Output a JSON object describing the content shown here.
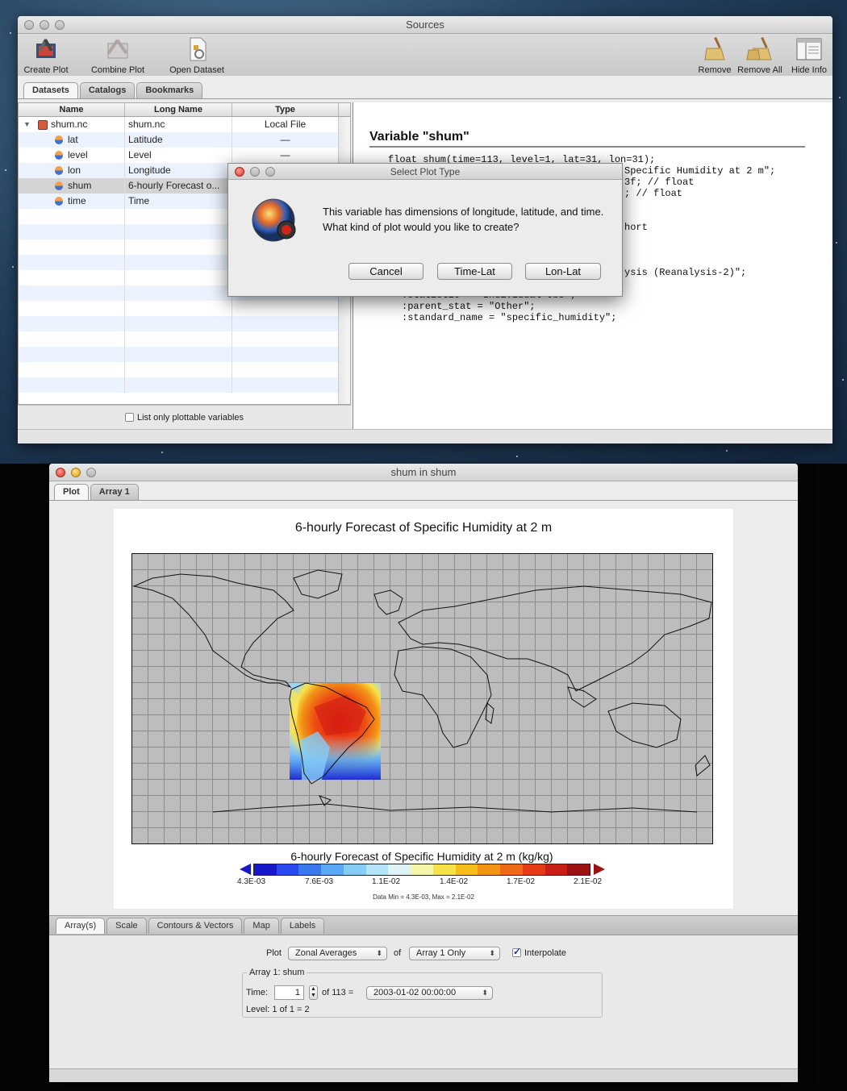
{
  "sources_window": {
    "title": "Sources",
    "toolbar": {
      "create_plot": "Create Plot",
      "combine_plot": "Combine Plot",
      "open_dataset": "Open Dataset",
      "remove": "Remove",
      "remove_all": "Remove All",
      "hide_info": "Hide Info"
    },
    "tabs": [
      "Datasets",
      "Catalogs",
      "Bookmarks"
    ],
    "table": {
      "columns": [
        "Name",
        "Long Name",
        "Type"
      ],
      "rows": [
        {
          "name": "shum.nc",
          "long_name": "shum.nc",
          "type": "Local File"
        },
        {
          "name": "lat",
          "long_name": "Latitude",
          "type": "—"
        },
        {
          "name": "level",
          "long_name": "Level",
          "type": "—"
        },
        {
          "name": "lon",
          "long_name": "Longitude",
          "type": ""
        },
        {
          "name": "shum",
          "long_name": "6-hourly Forecast o...",
          "type": ""
        },
        {
          "name": "time",
          "long_name": "Time",
          "type": ""
        }
      ]
    },
    "plottable_checkbox": "List only plottable variables",
    "info": {
      "title": "Variable \"shum\"",
      "code_lines": [
        "float shum(time=113, level=1, lat=31, lon=31);",
        "Specific Humidity at 2 m\";",
        "3f; // float",
        "; // float",
        "hort",
        "ysis (Reanalysis-2)\";",
        ":statistic = \"Individual Obs\";",
        ":parent_stat = \"Other\";",
        ":standard_name = \"specific_humidity\";"
      ]
    }
  },
  "dialog": {
    "title": "Select Plot Type",
    "message": "This variable has dimensions of longitude, latitude, and time. What kind of plot would you like to create?",
    "buttons": {
      "cancel": "Cancel",
      "time_lat": "Time-Lat",
      "lon_lat": "Lon-Lat"
    }
  },
  "plot_window": {
    "title": "shum in shum",
    "tabs": [
      "Plot",
      "Array 1"
    ],
    "plot_title": "6-hourly Forecast of Specific Humidity at 2 m",
    "colorbar_title": "6-hourly Forecast of Specific Humidity at 2 m (kg/kg)",
    "colorbar_ticks": [
      "4.3E-03",
      "7.6E-03",
      "1.1E-02",
      "1.4E-02",
      "1.7E-02",
      "2.1E-02"
    ],
    "colorbar_colors": [
      "#1818c8",
      "#2a4af0",
      "#3a78f0",
      "#5aa8f6",
      "#86ccf7",
      "#b6e3f7",
      "#dff3f5",
      "#f6f6a8",
      "#f8e24a",
      "#f7bd1a",
      "#f59314",
      "#ef6a16",
      "#e53a16",
      "#c81f16",
      "#9c1212"
    ],
    "data_range": "Data Min = 4.3E-03, Max = 2.1E-02",
    "bottom_tabs": [
      "Array(s)",
      "Scale",
      "Contours & Vectors",
      "Map",
      "Labels"
    ],
    "controls": {
      "plot_label": "Plot",
      "plot_value": "Zonal Averages",
      "of_label": "of",
      "array_value": "Array 1 Only",
      "interpolate": "Interpolate",
      "group_title": "Array 1: shum",
      "time_label": "Time:",
      "time_value": "1",
      "time_of": "of 113 =",
      "time_date": "2003-01-02 00:00:00",
      "level_text": "Level: 1 of 1 = 2"
    }
  }
}
